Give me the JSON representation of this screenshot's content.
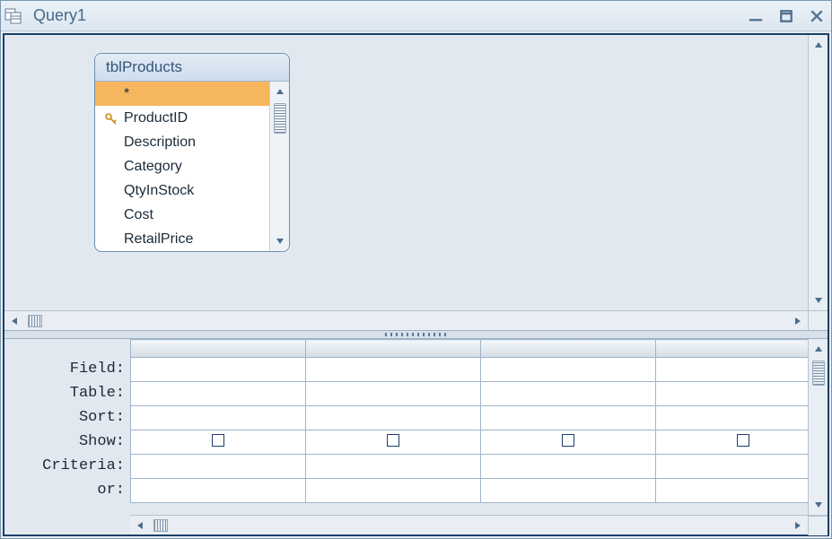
{
  "window": {
    "title": "Query1"
  },
  "table": {
    "name": "tblProducts",
    "fields": {
      "star": "*",
      "f0": "ProductID",
      "f1": "Description",
      "f2": "Category",
      "f3": "QtyInStock",
      "f4": "Cost",
      "f5": "RetailPrice"
    },
    "primary_key_field": "ProductID"
  },
  "qbe": {
    "row_labels": {
      "field": "Field:",
      "table": "Table:",
      "sort": "Sort:",
      "show": "Show:",
      "criteria": "Criteria:",
      "or": "or:"
    },
    "columns": 4,
    "show_checked": [
      false,
      false,
      false,
      false
    ]
  }
}
